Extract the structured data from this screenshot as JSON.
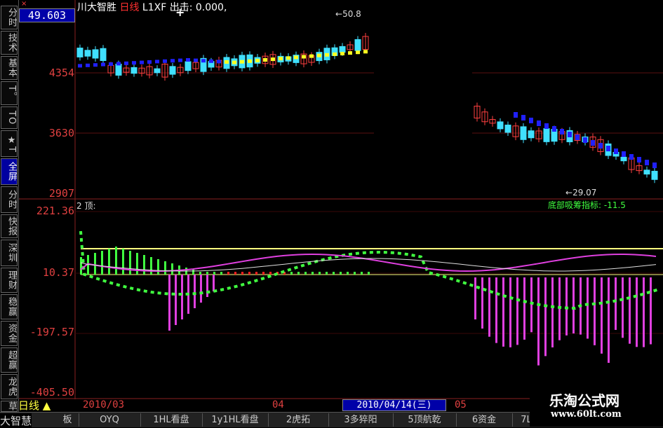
{
  "window": {
    "close_glyph": "×",
    "current_price": "49.603",
    "title_prefix": "川大智胜",
    "title_period": "日线",
    "title_suffix": "L1XF 出击: 0.000,",
    "cursor_glyph": "+"
  },
  "sidebar": {
    "items": [
      "分时",
      "技术",
      "基本",
      "T。",
      "TO",
      "★T",
      "全屏",
      "分时",
      "快报",
      "深圳",
      "理财",
      "稳赢",
      "资金",
      "超赢",
      "龙虎",
      "草"
    ]
  },
  "price_axis": {
    "labels": [
      "4354",
      "3630",
      "2907"
    ]
  },
  "indicator_axis": {
    "labels": [
      "221.36",
      "10.37",
      "-197.57",
      "-405.50"
    ]
  },
  "annotations": {
    "high_marker": "50.8",
    "low_marker": "29.07"
  },
  "panel2": {
    "title": "2 顶:",
    "indicator_label": "底部吸筹指标: -11.5"
  },
  "xaxis": {
    "period_label": "日线",
    "ticks": [
      "2010/03",
      "04",
      "05"
    ],
    "cursor_date": "2010/04/14(三)"
  },
  "tabs": [
    "板",
    "OYQ",
    "1HL看盘",
    "1y1HL看盘",
    "2虎拓",
    "3多猝阳",
    "5顶航乾",
    "6资金",
    "7L"
  ],
  "brand": "大智慧",
  "watermark": {
    "title": "乐淘公式网",
    "url": "www.60lt.com"
  },
  "colors": {
    "up_candle": "#ff4040",
    "down_candle": "#40e0ff",
    "ma_blue": "#2020ff",
    "ma_yellow": "#ffff20",
    "ind_green": "#40ff40",
    "ind_magenta": "#e040e0",
    "ind_red": "#ff2020",
    "ref_line": "#ffff80"
  }
}
